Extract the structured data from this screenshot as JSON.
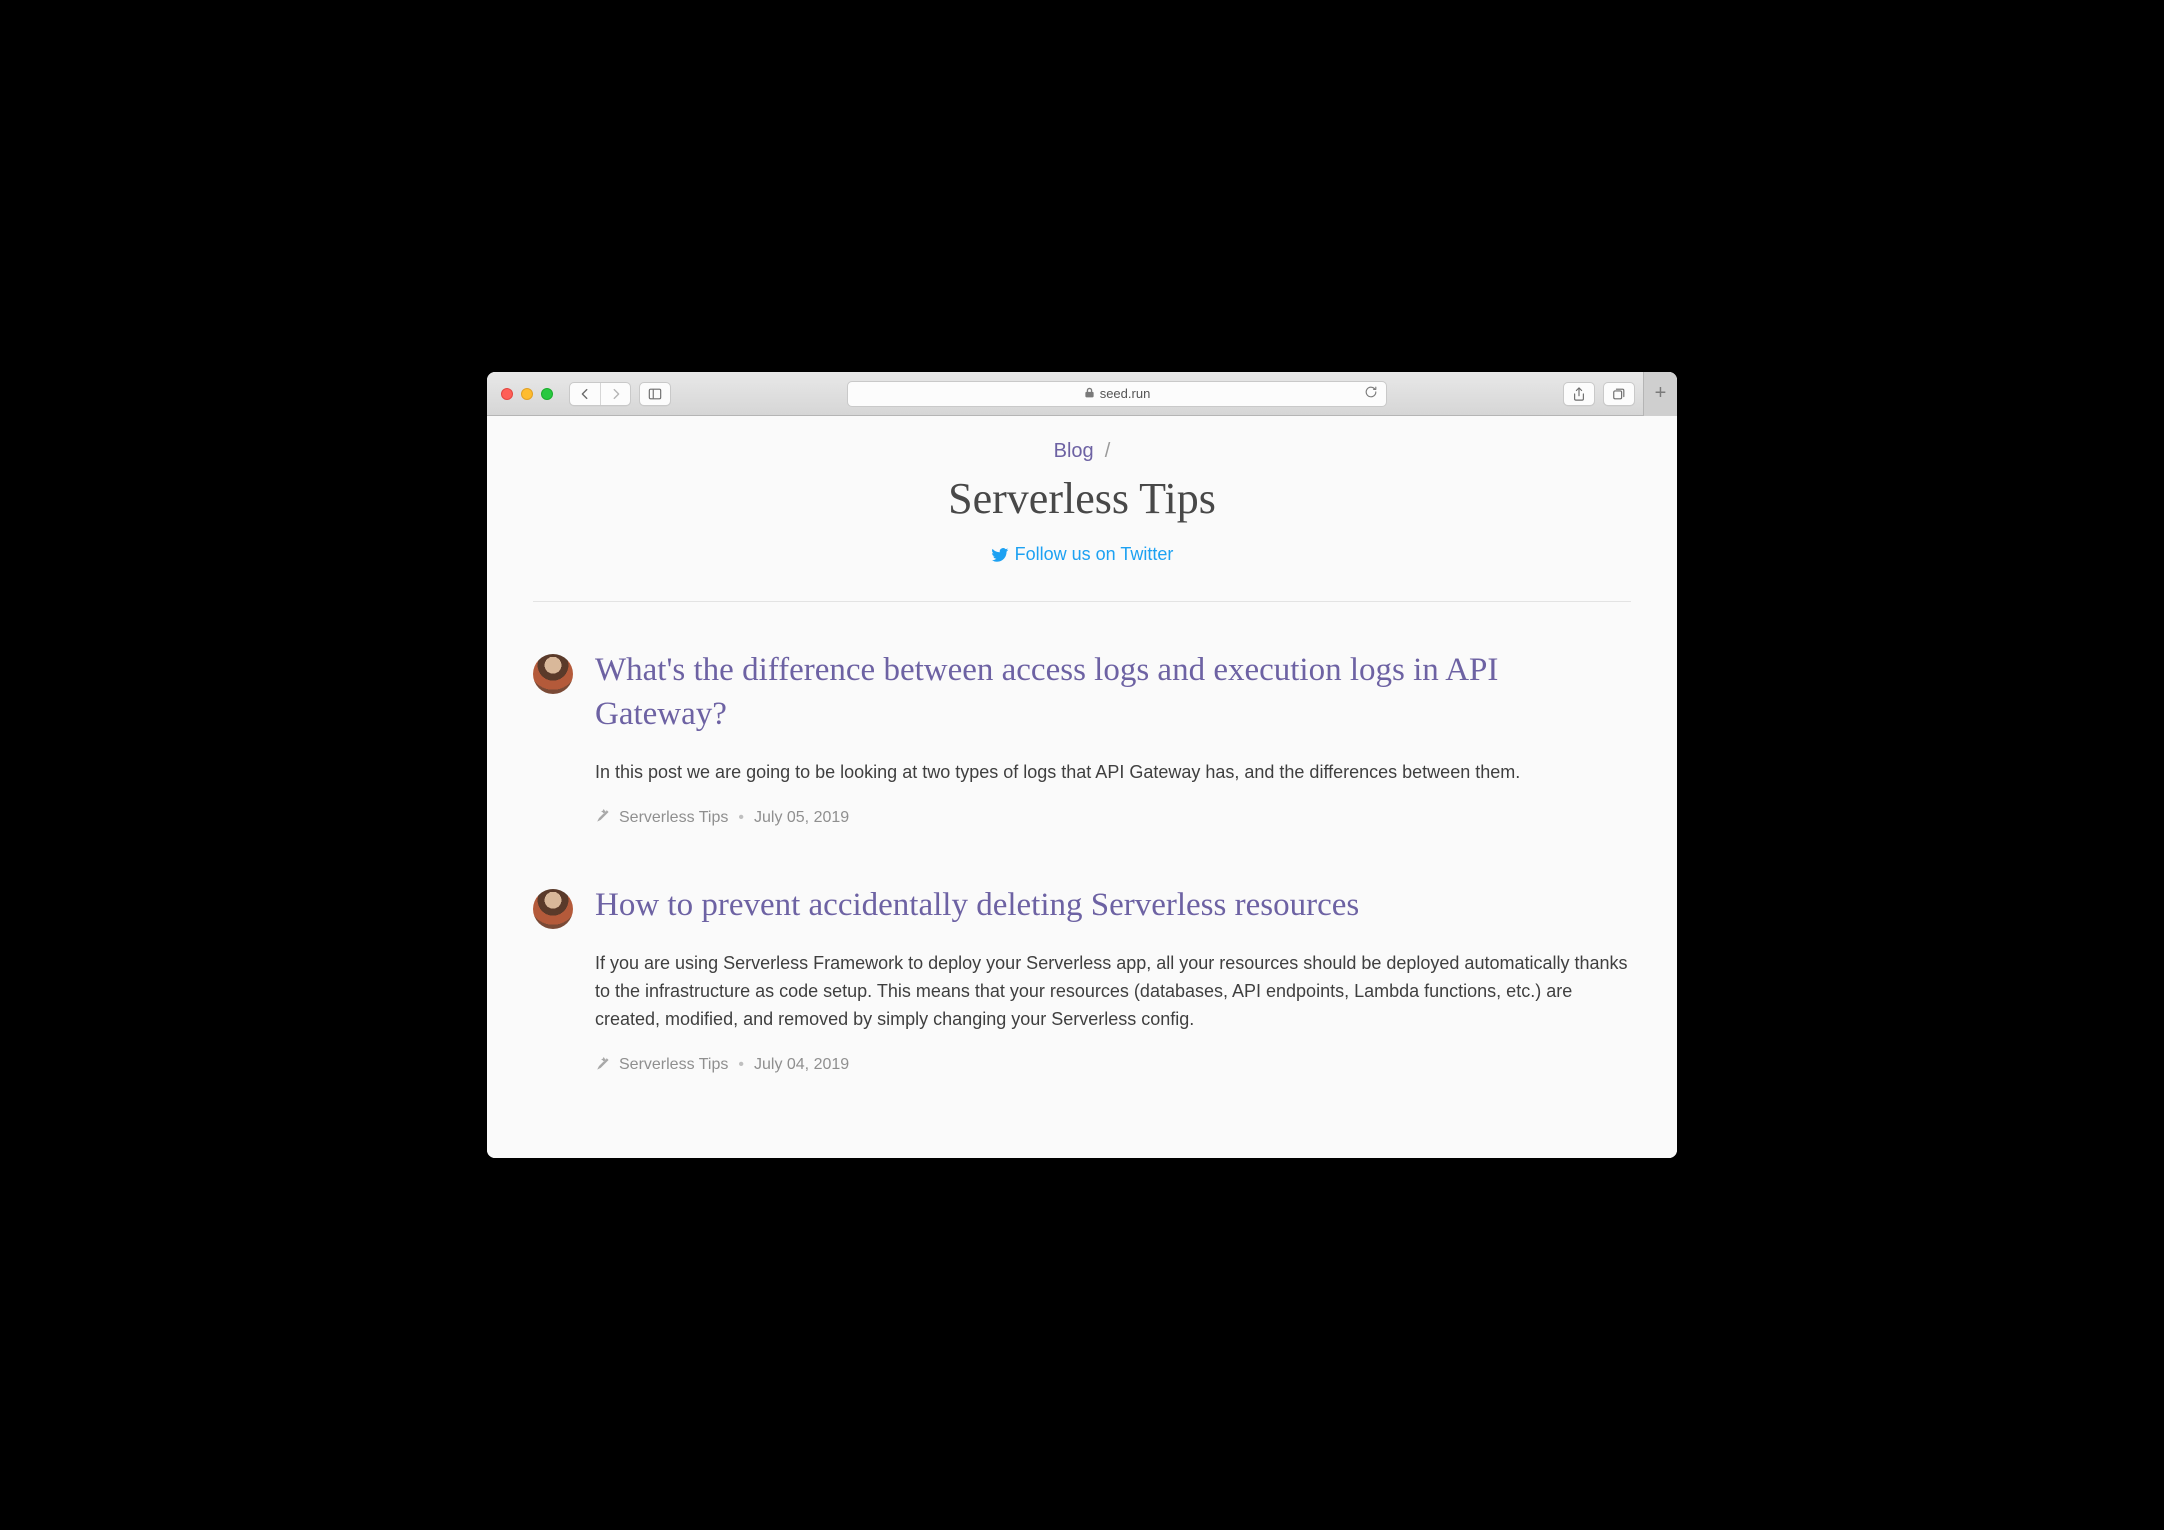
{
  "browser": {
    "url_display": "seed.run"
  },
  "breadcrumb": {
    "parent": "Blog",
    "separator": "/"
  },
  "page": {
    "title": "Serverless Tips",
    "twitter_cta": "Follow us on Twitter"
  },
  "posts": [
    {
      "title": "What's the difference between access logs and execution logs in API Gateway?",
      "excerpt": "In this post we are going to be looking at two types of logs that API Gateway has, and the differences between them.",
      "category": "Serverless Tips",
      "date": "July 05, 2019"
    },
    {
      "title": "How to prevent accidentally deleting Serverless resources",
      "excerpt": "If you are using Serverless Framework to deploy your Serverless app, all your resources should be deployed automatically thanks to the infrastructure as code setup. This means that your resources (databases, API endpoints, Lambda functions, etc.) are created, modified, and removed by simply changing your Serverless config.",
      "category": "Serverless Tips",
      "date": "July 04, 2019"
    }
  ]
}
